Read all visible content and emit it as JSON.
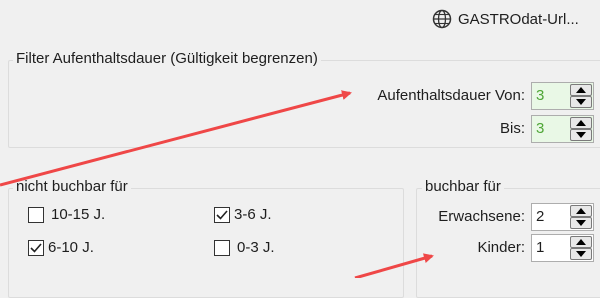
{
  "header": {
    "app_button": {
      "label": "GASTROdat-Url...",
      "icon": "globe-icon"
    }
  },
  "filter_group": {
    "title": "Filter Aufenthaltsdauer (Gültigkeit begrenzen)",
    "from": {
      "label": "Aufenthaltsdauer Von:",
      "value": "3"
    },
    "to": {
      "label": "Bis:",
      "value": "3"
    }
  },
  "not_bookable_group": {
    "title": "nicht buchbar für",
    "options": [
      {
        "label": "10-15 J.",
        "checked": false
      },
      {
        "label": "3-6 J.",
        "checked": true
      },
      {
        "label": "6-10 J.",
        "checked": true
      },
      {
        "label": "0-3 J.",
        "checked": false
      }
    ]
  },
  "bookable_group": {
    "title": "buchbar für",
    "adults": {
      "label": "Erwachsene:",
      "value": "2"
    },
    "children": {
      "label": "Kinder:",
      "value": "1"
    }
  },
  "colors": {
    "annotation_arrow": "#ef4747",
    "spin_green_bg": "#e9f8e6",
    "spin_green_text": "#4fa637",
    "window_bg": "#f0f0f0"
  }
}
